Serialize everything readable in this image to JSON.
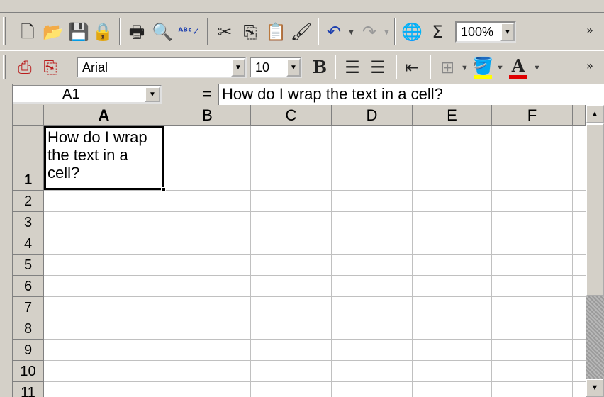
{
  "toolbar1": {
    "icons": [
      "new-icon",
      "open-icon",
      "save-icon",
      "permission-icon",
      "print-icon",
      "print-preview-icon",
      "spelling-icon",
      "cut-icon",
      "copy-icon",
      "paste-icon",
      "format-painter-icon",
      "undo-icon",
      "redo-icon",
      "hyperlink-icon",
      "autosum-icon"
    ],
    "zoom": "100%",
    "more": "»"
  },
  "toolbar2": {
    "font": "Arial",
    "size": "10",
    "bold": "B",
    "more": "»"
  },
  "formula_bar": {
    "name_box": "A1",
    "equals": "=",
    "content": "How do I wrap the text in a cell?"
  },
  "sheet": {
    "columns": [
      "A",
      "B",
      "C",
      "D",
      "E",
      "F"
    ],
    "rows": [
      "1",
      "2",
      "3",
      "4",
      "5",
      "6",
      "7",
      "8",
      "9",
      "10",
      "11"
    ],
    "selected_cell": "A1",
    "a1_value": "How do I wrap the text in a cell?"
  }
}
